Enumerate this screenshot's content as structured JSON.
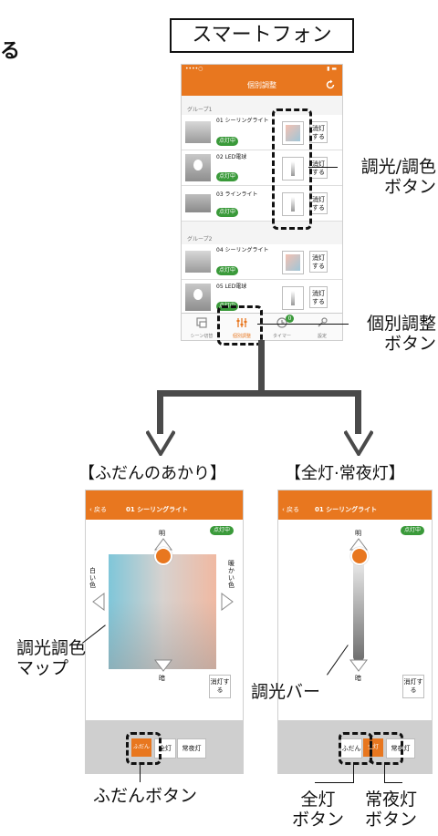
{
  "page": {
    "left_fragment": "る",
    "smartphone_label": "スマートフォン",
    "callouts": {
      "chouko_btn": "調光/調色\nボタン",
      "kobetsu_btn": "個別調整\nボタン",
      "fudan_mode": "【ふだんのあかり】",
      "zento_mode": "【全灯·常夜灯】",
      "map": "調光調色\nマップ",
      "bar": "調光バー",
      "fudan_btn": "ふだんボタン",
      "zento_btn": "全灯\nボタン",
      "joyato_btn": "常夜灯\nボタン"
    }
  },
  "main_phone": {
    "status_left": "••••○",
    "status_right": "▮ ▬",
    "title": "個別調整",
    "groups": [
      {
        "label": "グループ1",
        "items": [
          {
            "name": "01 シーリングライト",
            "status": "点灯中",
            "swatch": "gradient",
            "off_label": "消灯する"
          },
          {
            "name": "02 LED電球",
            "status": "点灯中",
            "swatch": "bar",
            "off_label": "消灯する"
          },
          {
            "name": "03 ラインライト",
            "status": "点灯中",
            "swatch": "bar",
            "off_label": "消灯する"
          }
        ]
      },
      {
        "label": "グループ2",
        "items": [
          {
            "name": "04 シーリングライト",
            "status": "点灯中",
            "swatch": "gradient",
            "off_label": "消灯する"
          },
          {
            "name": "05 LED電球",
            "status": "点灯中",
            "swatch": "bar",
            "off_label": "消灯する"
          }
        ]
      }
    ],
    "tabs": [
      {
        "label": "シーン切替",
        "icon": "scene-icon"
      },
      {
        "label": "個別調整",
        "icon": "sliders-icon"
      },
      {
        "label": "タイマー",
        "icon": "clock-icon"
      },
      {
        "label": "設定",
        "icon": "wrench-icon"
      }
    ],
    "timer_badge": "0"
  },
  "fudan_phone": {
    "back": "戻る",
    "title": "01 シーリングライト",
    "status": "点灯中",
    "bright": "明",
    "dark": "暗",
    "white": "白い色",
    "warm": "暖かい色",
    "off": "消灯する",
    "modes": [
      "ふだん",
      "全灯",
      "常夜灯"
    ]
  },
  "zento_phone": {
    "back": "戻る",
    "title": "01 シーリングライト",
    "status": "点灯中",
    "bright": "明",
    "dark": "暗",
    "off": "消灯する",
    "modes": [
      "ふだん",
      "全灯",
      "常夜灯"
    ]
  },
  "colors": {
    "accent": "#e8771f",
    "status_green": "#3a9a3a"
  }
}
